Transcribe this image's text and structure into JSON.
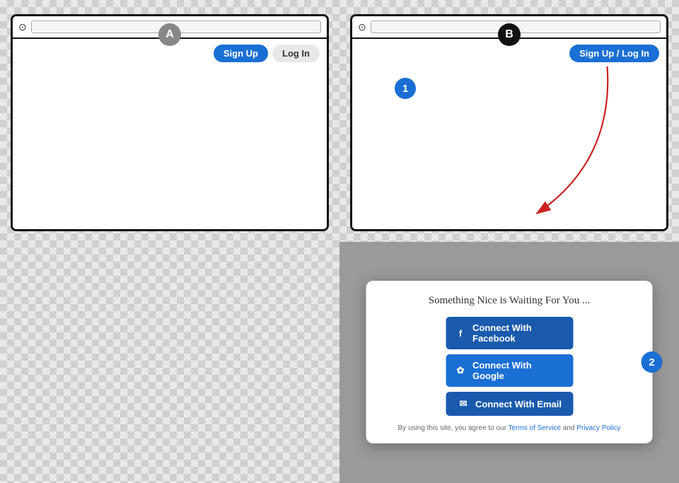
{
  "quadrantA": {
    "label": "A",
    "signupBtn": "Sign Up",
    "loginBtn": "Log In"
  },
  "quadrantB": {
    "label": "B",
    "signupLoginBtn": "Sign Up / Log In",
    "step1": "1"
  },
  "quadrantD": {
    "step2": "2",
    "modalTitle": "Something Nice is Waiting For You ...",
    "facebookBtn": "Connect With Facebook",
    "googleBtn": "Connect With Google",
    "emailBtn": "Connect With Email",
    "termsText": "By using this site, you agree to our ",
    "termsOfService": "Terms of Service",
    "termsAnd": " and ",
    "privacyPolicy": "Privacy Policy"
  }
}
